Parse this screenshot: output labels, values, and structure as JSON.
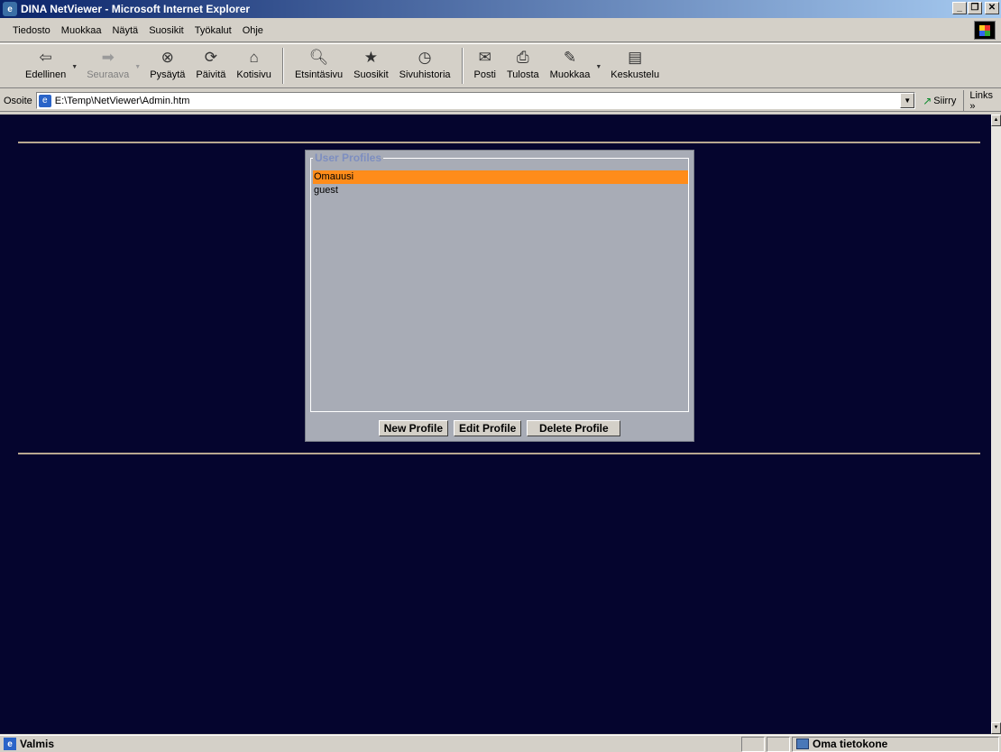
{
  "window": {
    "title": "DINA NetViewer - Microsoft Internet Explorer"
  },
  "menu": [
    "Tiedosto",
    "Muokkaa",
    "Näytä",
    "Suosikit",
    "Työkalut",
    "Ohje"
  ],
  "toolbar": {
    "back": "Edellinen",
    "forward": "Seuraava",
    "stop": "Pysäytä",
    "refresh": "Päivitä",
    "home": "Kotisivu",
    "search": "Etsintäsivu",
    "favorites": "Suosikit",
    "history": "Sivuhistoria",
    "mail": "Posti",
    "print": "Tulosta",
    "edit": "Muokkaa",
    "discuss": "Keskustelu"
  },
  "address": {
    "label": "Osoite",
    "url": "E:\\Temp\\NetViewer\\Admin.htm",
    "go": "Siirry",
    "links": "Links"
  },
  "profiles": {
    "legend": "User Profiles",
    "items": [
      "Omauusi",
      "guest"
    ],
    "selected": "Omauusi",
    "new_button": "New Profile",
    "edit_button": "Edit Profile",
    "delete_button": "Delete Profile"
  },
  "status": {
    "text": "Valmis",
    "zone": "Oma tietokone"
  },
  "colors": {
    "content_bg": "#05052e",
    "selected": "#ff8c1a",
    "panel": "#a8acb6",
    "legend": "#7d8ec0"
  }
}
